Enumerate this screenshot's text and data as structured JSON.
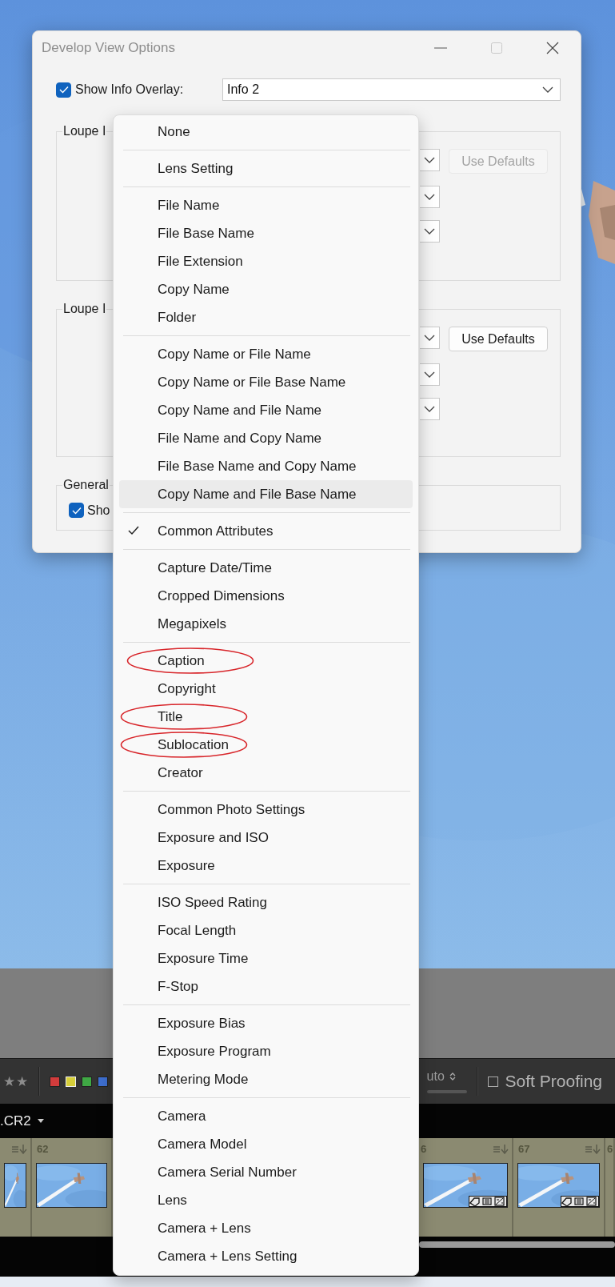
{
  "dialog": {
    "title": "Develop View Options",
    "show_info_overlay": {
      "label": "Show Info Overlay:",
      "checked": true
    },
    "overlay_select": {
      "value": "Info 2"
    },
    "groups": [
      {
        "label": "Loupe I",
        "kind": "selects",
        "button": {
          "label": "Use Defaults",
          "disabled": true
        }
      },
      {
        "label": "Loupe I",
        "kind": "selects",
        "button": {
          "label": "Use Defaults",
          "disabled": false
        }
      },
      {
        "label": "General",
        "kind": "checkbox",
        "checkbox": {
          "label": "Sho",
          "checked": true
        }
      }
    ]
  },
  "menu": {
    "sections": [
      {
        "items": [
          {
            "label": "None",
            "checked": false,
            "highlighted": false,
            "circled": false
          }
        ]
      },
      {
        "items": [
          {
            "label": "Lens Setting",
            "checked": false,
            "highlighted": false,
            "circled": false
          }
        ]
      },
      {
        "items": [
          {
            "label": "File Name",
            "checked": false,
            "highlighted": false,
            "circled": false
          },
          {
            "label": "File Base Name",
            "checked": false,
            "highlighted": false,
            "circled": false
          },
          {
            "label": "File Extension",
            "checked": false,
            "highlighted": false,
            "circled": false
          },
          {
            "label": "Copy Name",
            "checked": false,
            "highlighted": false,
            "circled": false
          },
          {
            "label": "Folder",
            "checked": false,
            "highlighted": false,
            "circled": false
          }
        ]
      },
      {
        "items": [
          {
            "label": "Copy Name or File Name",
            "checked": false,
            "highlighted": false,
            "circled": false
          },
          {
            "label": "Copy Name or File Base Name",
            "checked": false,
            "highlighted": false,
            "circled": false
          },
          {
            "label": "Copy Name and File Name",
            "checked": false,
            "highlighted": false,
            "circled": false
          },
          {
            "label": "File Name and Copy Name",
            "checked": false,
            "highlighted": false,
            "circled": false
          },
          {
            "label": "File Base Name and Copy Name",
            "checked": false,
            "highlighted": false,
            "circled": false
          },
          {
            "label": "Copy Name and File Base Name",
            "checked": false,
            "highlighted": true,
            "circled": false
          }
        ]
      },
      {
        "items": [
          {
            "label": "Common Attributes",
            "checked": true,
            "highlighted": false,
            "circled": false
          }
        ]
      },
      {
        "items": [
          {
            "label": "Capture Date/Time",
            "checked": false,
            "highlighted": false,
            "circled": false
          },
          {
            "label": "Cropped Dimensions",
            "checked": false,
            "highlighted": false,
            "circled": false
          },
          {
            "label": "Megapixels",
            "checked": false,
            "highlighted": false,
            "circled": false
          }
        ]
      },
      {
        "items": [
          {
            "label": "Caption",
            "checked": false,
            "highlighted": false,
            "circled": true
          },
          {
            "label": "Copyright",
            "checked": false,
            "highlighted": false,
            "circled": false
          },
          {
            "label": "Title",
            "checked": false,
            "highlighted": false,
            "circled": true
          },
          {
            "label": "Sublocation",
            "checked": false,
            "highlighted": false,
            "circled": true
          },
          {
            "label": "Creator",
            "checked": false,
            "highlighted": false,
            "circled": false
          }
        ]
      },
      {
        "items": [
          {
            "label": "Common Photo Settings",
            "checked": false,
            "highlighted": false,
            "circled": false
          },
          {
            "label": "Exposure and ISO",
            "checked": false,
            "highlighted": false,
            "circled": false
          },
          {
            "label": "Exposure",
            "checked": false,
            "highlighted": false,
            "circled": false
          }
        ]
      },
      {
        "items": [
          {
            "label": "ISO Speed Rating",
            "checked": false,
            "highlighted": false,
            "circled": false
          },
          {
            "label": "Focal Length",
            "checked": false,
            "highlighted": false,
            "circled": false
          },
          {
            "label": "Exposure Time",
            "checked": false,
            "highlighted": false,
            "circled": false
          },
          {
            "label": "F-Stop",
            "checked": false,
            "highlighted": false,
            "circled": false
          }
        ]
      },
      {
        "items": [
          {
            "label": "Exposure Bias",
            "checked": false,
            "highlighted": false,
            "circled": false
          },
          {
            "label": "Exposure Program",
            "checked": false,
            "highlighted": false,
            "circled": false
          },
          {
            "label": "Metering Mode",
            "checked": false,
            "highlighted": false,
            "circled": false
          }
        ]
      },
      {
        "items": [
          {
            "label": "Camera",
            "checked": false,
            "highlighted": false,
            "circled": false
          },
          {
            "label": "Camera Model",
            "checked": false,
            "highlighted": false,
            "circled": false
          },
          {
            "label": "Camera Serial Number",
            "checked": false,
            "highlighted": false,
            "circled": false
          },
          {
            "label": "Lens",
            "checked": false,
            "highlighted": false,
            "circled": false
          },
          {
            "label": "Camera + Lens",
            "checked": false,
            "highlighted": false,
            "circled": false
          },
          {
            "label": "Camera + Lens Setting",
            "checked": false,
            "highlighted": false,
            "circled": false
          }
        ]
      }
    ]
  },
  "toolbar": {
    "stars": "★★",
    "color_labels": [
      {
        "color": "#d23c3c",
        "selected": false
      },
      {
        "color": "#d6cf3a",
        "selected": true
      },
      {
        "color": "#3fa844",
        "selected": false
      },
      {
        "color": "#3e6fd0",
        "selected": false
      }
    ],
    "auto_text": "uto",
    "soft_proofing": {
      "label": "Soft Proofing",
      "checked": false
    }
  },
  "path_bar": {
    "text": ".CR2"
  },
  "filmstrip": {
    "cells": [
      {
        "number": "62"
      },
      {
        "number": "6"
      },
      {
        "number": "67"
      },
      {
        "number": "6"
      }
    ]
  }
}
